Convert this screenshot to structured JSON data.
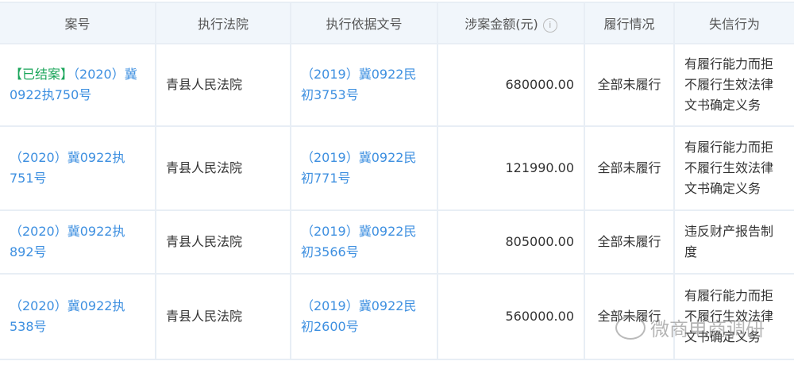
{
  "headers": [
    "案号",
    "执行法院",
    "执行依据文号",
    "涉案金额(元)",
    "履行情况",
    "失信行为"
  ],
  "rows": [
    {
      "tag": "【已结案】",
      "case": "（2020）冀0922执750号",
      "court": "青县人民法院",
      "basis": "（2019）冀0922民初3753号",
      "amount": "680000.00",
      "status": "全部未履行",
      "behavior": "有履行能力而拒不履行生效法律文书确定义务"
    },
    {
      "tag": "",
      "case": "（2020）冀0922执751号",
      "court": "青县人民法院",
      "basis": "（2019）冀0922民初771号",
      "amount": "121990.00",
      "status": "全部未履行",
      "behavior": "有履行能力而拒不履行生效法律文书确定义务"
    },
    {
      "tag": "",
      "case": "（2020）冀0922执892号",
      "court": "青县人民法院",
      "basis": "（2019）冀0922民初3566号",
      "amount": "805000.00",
      "status": "全部未履行",
      "behavior": "违反财产报告制度"
    },
    {
      "tag": "",
      "case": "（2020）冀0922执538号",
      "court": "青县人民法院",
      "basis": "（2019）冀0922民初2600号",
      "amount": "560000.00",
      "status": "全部未履行",
      "behavior": "有履行能力而拒不履行生效法律文书确定义务"
    }
  ],
  "info_icon": "i",
  "watermark": "微商电商调研"
}
